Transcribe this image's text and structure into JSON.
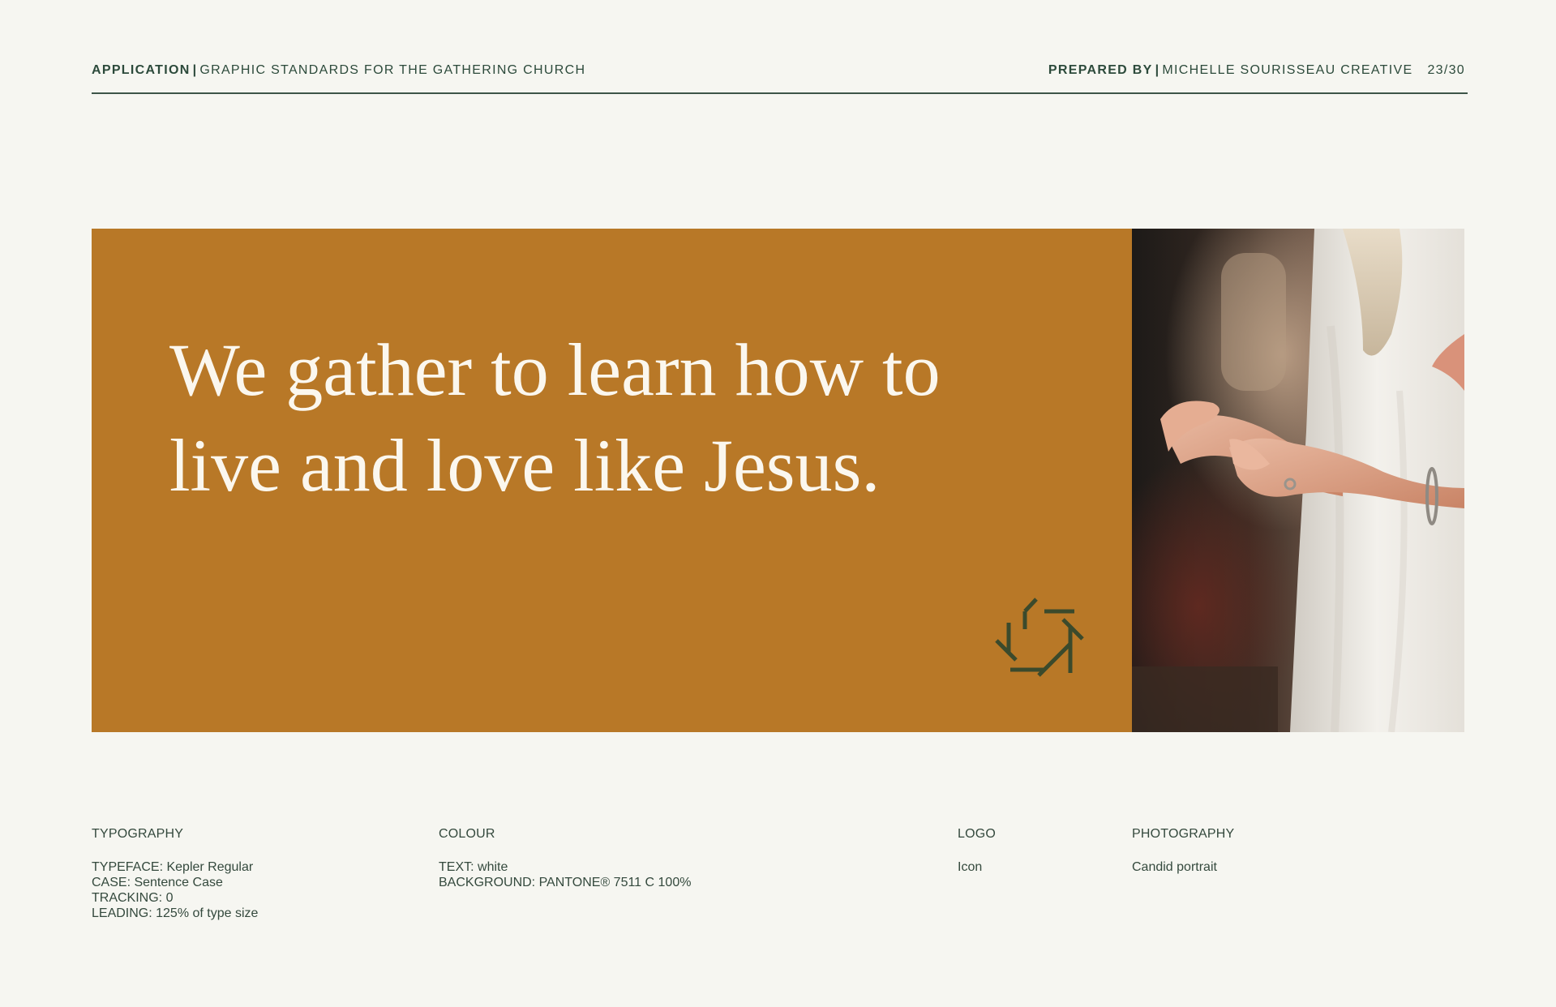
{
  "header": {
    "left_label": "APPLICATION",
    "left_separator": "|",
    "left_text": "GRAPHIC STANDARDS FOR THE GATHERING CHURCH",
    "right_label": "PREPARED BY",
    "right_separator": "|",
    "right_text": "MICHELLE SOURISSEAU CREATIVE",
    "page": "23/30"
  },
  "banner": {
    "headline_line1": "We gather to learn how to",
    "headline_line2": "live and love like Jesus.",
    "background_color": "#b87827",
    "text_color": "#fbf7ee",
    "logo_icon": "gathering-church-star-icon",
    "logo_color": "#3b4a2c"
  },
  "photo": {
    "icon": "photo-hands-raised"
  },
  "specs": {
    "typography": {
      "title": "TYPOGRAPHY",
      "lines": [
        "TYPEFACE: Kepler Regular",
        "CASE: Sentence Case",
        "TRACKING: 0",
        "LEADING: 125% of type size"
      ]
    },
    "colour": {
      "title": "COLOUR",
      "lines": [
        "TEXT: white",
        "BACKGROUND: PANTONE® 7511 C 100%"
      ]
    },
    "logo": {
      "title": "LOGO",
      "lines": [
        "Icon"
      ]
    },
    "photography": {
      "title": "PHOTOGRAPHY",
      "lines": [
        "Candid portrait"
      ]
    }
  }
}
